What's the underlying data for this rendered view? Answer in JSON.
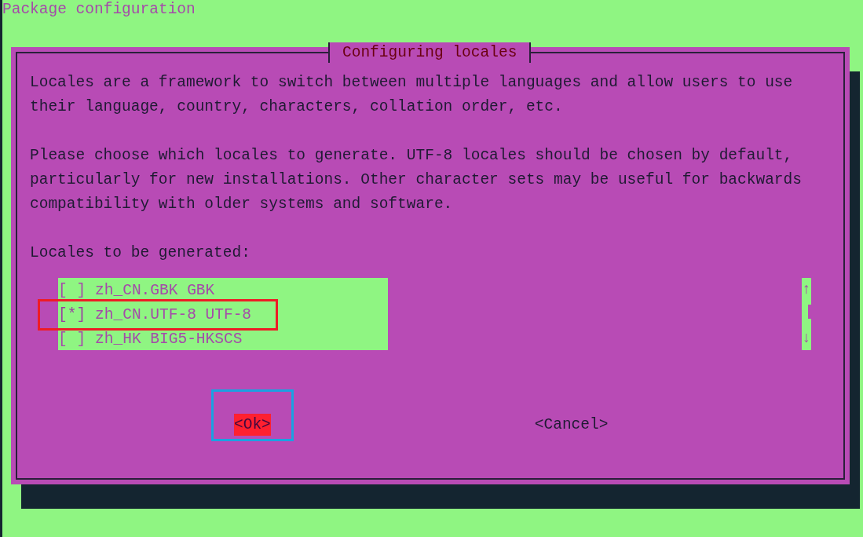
{
  "window": {
    "title": "Package configuration"
  },
  "dialog": {
    "title": "Configuring locales",
    "paragraphs": [
      "Locales are a framework to switch between multiple languages and allow users to use\ntheir language, country, characters, collation order, etc.",
      "Please choose which locales to generate. UTF-8 locales should be chosen by default,\nparticularly for new installations. Other character sets may be useful for backwards\ncompatibility with older systems and software."
    ],
    "list_label": "Locales to be generated:",
    "locales": [
      {
        "box": "[ ]",
        "name": "zh_CN.GBK GBK",
        "checked": false
      },
      {
        "box": "[*]",
        "name": "zh_CN.UTF-8 UTF-8",
        "checked": true
      },
      {
        "box": "[ ]",
        "name": "zh_HK BIG5-HKSCS",
        "checked": false
      }
    ],
    "scrollbar": {
      "up": "↑",
      "down": "↓"
    },
    "buttons": [
      {
        "label": "<Ok>",
        "selected": true
      },
      {
        "label": "<Cancel>",
        "selected": false
      }
    ]
  }
}
